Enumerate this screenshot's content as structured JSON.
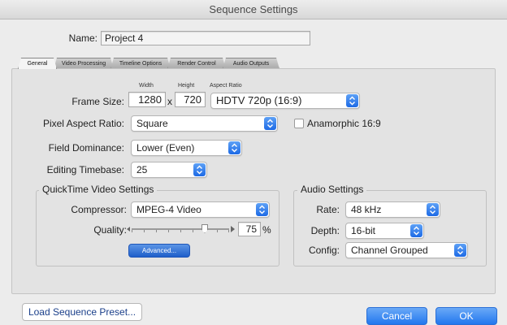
{
  "window": {
    "title": "Sequence Settings"
  },
  "name": {
    "label": "Name:",
    "value": "Project 4"
  },
  "tabs": [
    {
      "label": "General",
      "active": true
    },
    {
      "label": "Video Processing",
      "active": false
    },
    {
      "label": "Timeline Options",
      "active": false
    },
    {
      "label": "Render Control",
      "active": false
    },
    {
      "label": "Audio Outputs",
      "active": false
    }
  ],
  "general": {
    "frame_size": {
      "label": "Frame Size:",
      "width_caption": "Width",
      "height_caption": "Height",
      "aspect_caption": "Aspect Ratio",
      "width": "1280",
      "x": "x",
      "height": "720",
      "aspect_ratio": "HDTV 720p (16:9)"
    },
    "pixel_aspect": {
      "label": "Pixel Aspect Ratio:",
      "value": "Square"
    },
    "anamorphic": {
      "label": "Anamorphic 16:9",
      "checked": false
    },
    "field_dominance": {
      "label": "Field Dominance:",
      "value": "Lower (Even)"
    },
    "editing_timebase": {
      "label": "Editing Timebase:",
      "value": "25"
    }
  },
  "quicktime": {
    "title": "QuickTime Video Settings",
    "compressor_label": "Compressor:",
    "compressor": "MPEG-4 Video",
    "quality_label": "Quality:",
    "quality_value": "75",
    "quality_unit": "%",
    "quality_fraction": 0.75,
    "advanced_label": "Advanced..."
  },
  "audio": {
    "title": "Audio Settings",
    "rate_label": "Rate:",
    "rate": "48 kHz",
    "depth_label": "Depth:",
    "depth": "16-bit",
    "config_label": "Config:",
    "config": "Channel Grouped"
  },
  "footer": {
    "load_preset": "Load Sequence Preset...",
    "cancel": "Cancel",
    "ok": "OK"
  },
  "colors": {
    "accent": "#2277ee",
    "window_bg": "#ececec",
    "pane_bg": "#e3e3e3"
  },
  "icons": {
    "popup": "popup-arrows-icon",
    "slider_left": "small-triangle-icon",
    "slider_right": "large-triangle-icon"
  }
}
